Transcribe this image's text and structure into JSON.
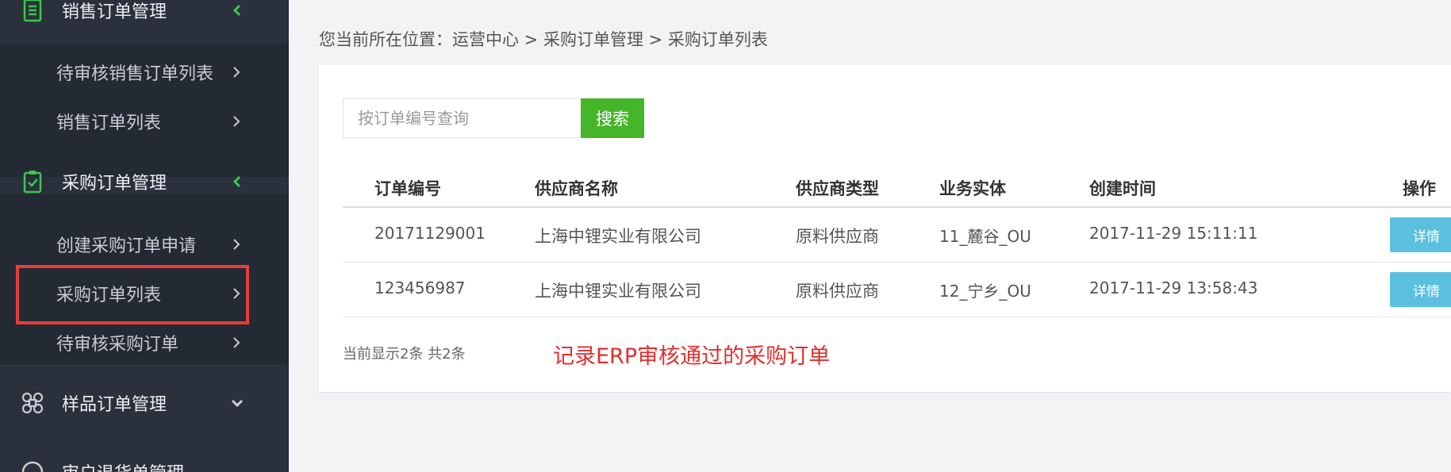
{
  "sidebar": {
    "groups": [
      {
        "label": "销售订单管理",
        "icon": "list-doc-icon",
        "expanded": true
      },
      {
        "label": "采购订单管理",
        "icon": "clipboard-check-icon",
        "expanded": true
      },
      {
        "label": "样品订单管理",
        "icon": "command-icon",
        "expanded": false
      },
      {
        "label": "审户退货单管理",
        "icon": "circle-icon",
        "expanded": false
      }
    ],
    "sales_items": [
      {
        "label": "待审核销售订单列表"
      },
      {
        "label": "销售订单列表"
      }
    ],
    "purchase_items": [
      {
        "label": "创建采购订单申请"
      },
      {
        "label": "采购订单列表",
        "active": true
      },
      {
        "label": "待审核采购订单"
      }
    ]
  },
  "breadcrumb": {
    "text": "您当前所在位置：运营中心 > 采购订单管理 > 采购订单列表"
  },
  "search": {
    "placeholder": "按订单编号查询",
    "value": "",
    "button_label": "搜索"
  },
  "table": {
    "headers": [
      "订单编号",
      "供应商名称",
      "供应商类型",
      "业务实体",
      "创建时间",
      "操作"
    ],
    "rows": [
      {
        "order_no": "20171129001",
        "supplier": "上海中锂实业有限公司",
        "supplier_type": "原料供应商",
        "entity": "11_麓谷_OU",
        "created": "2017-11-29 15:11:11",
        "action": "详情"
      },
      {
        "order_no": "123456987",
        "supplier": "上海中锂实业有限公司",
        "supplier_type": "原料供应商",
        "entity": "12_宁乡_OU",
        "created": "2017-11-29 13:58:43",
        "action": "详情"
      }
    ]
  },
  "footer": {
    "count_text": "当前显示2条 共2条"
  },
  "annotation": {
    "text": "记录ERP审核通过的采购订单"
  },
  "colors": {
    "sidebar_bg": "#2a313c",
    "accent_green": "#3cc84a",
    "search_button": "#45b52a",
    "detail_button": "#5bc0de",
    "highlight_border": "#e83b3b",
    "annotation_text": "#e0302e"
  }
}
